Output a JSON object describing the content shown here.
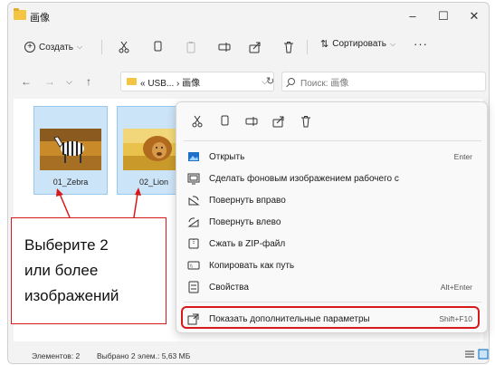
{
  "window": {
    "title": "画像"
  },
  "titlebar": {
    "minimize": "–",
    "maximize": "☐",
    "close": "✕"
  },
  "toolbar": {
    "create_label": "Создать",
    "sort_label": "Сортировать",
    "more_label": "···"
  },
  "address": {
    "path": "« USB... › 画像",
    "search_placeholder": "Поиск: 画像"
  },
  "files": [
    {
      "name": "01_Zebra",
      "icon": "zebra-thumbnail"
    },
    {
      "name": "02_Lion",
      "icon": "lion-thumbnail"
    }
  ],
  "context_menu": {
    "items": [
      {
        "label": "Открыть",
        "shortcut": "Enter",
        "icon": "image-icon"
      },
      {
        "label": "Сделать фоновым изображением рабочего с",
        "shortcut": "",
        "icon": "wallpaper-icon"
      },
      {
        "label": "Повернуть вправо",
        "shortcut": "",
        "icon": "rotate-right-icon"
      },
      {
        "label": "Повернуть влево",
        "shortcut": "",
        "icon": "rotate-left-icon"
      },
      {
        "label": "Сжать в ZIP-файл",
        "shortcut": "",
        "icon": "zip-icon"
      },
      {
        "label": "Копировать как путь",
        "shortcut": "",
        "icon": "copy-path-icon"
      },
      {
        "label": "Свойства",
        "shortcut": "Alt+Enter",
        "icon": "properties-icon"
      }
    ],
    "more_options": {
      "label": "Показать дополнительные параметры",
      "shortcut": "Shift+F10"
    }
  },
  "annotation": {
    "lines": [
      "Выберите 2",
      "или более",
      "изображений"
    ]
  },
  "status": {
    "count": "Элементов: 2",
    "selected": "Выбрано 2 элем.: 5,63 МБ"
  },
  "colors": {
    "accent": "#0067c0",
    "annotation": "#d7191c",
    "selection": "#cce4f7"
  }
}
